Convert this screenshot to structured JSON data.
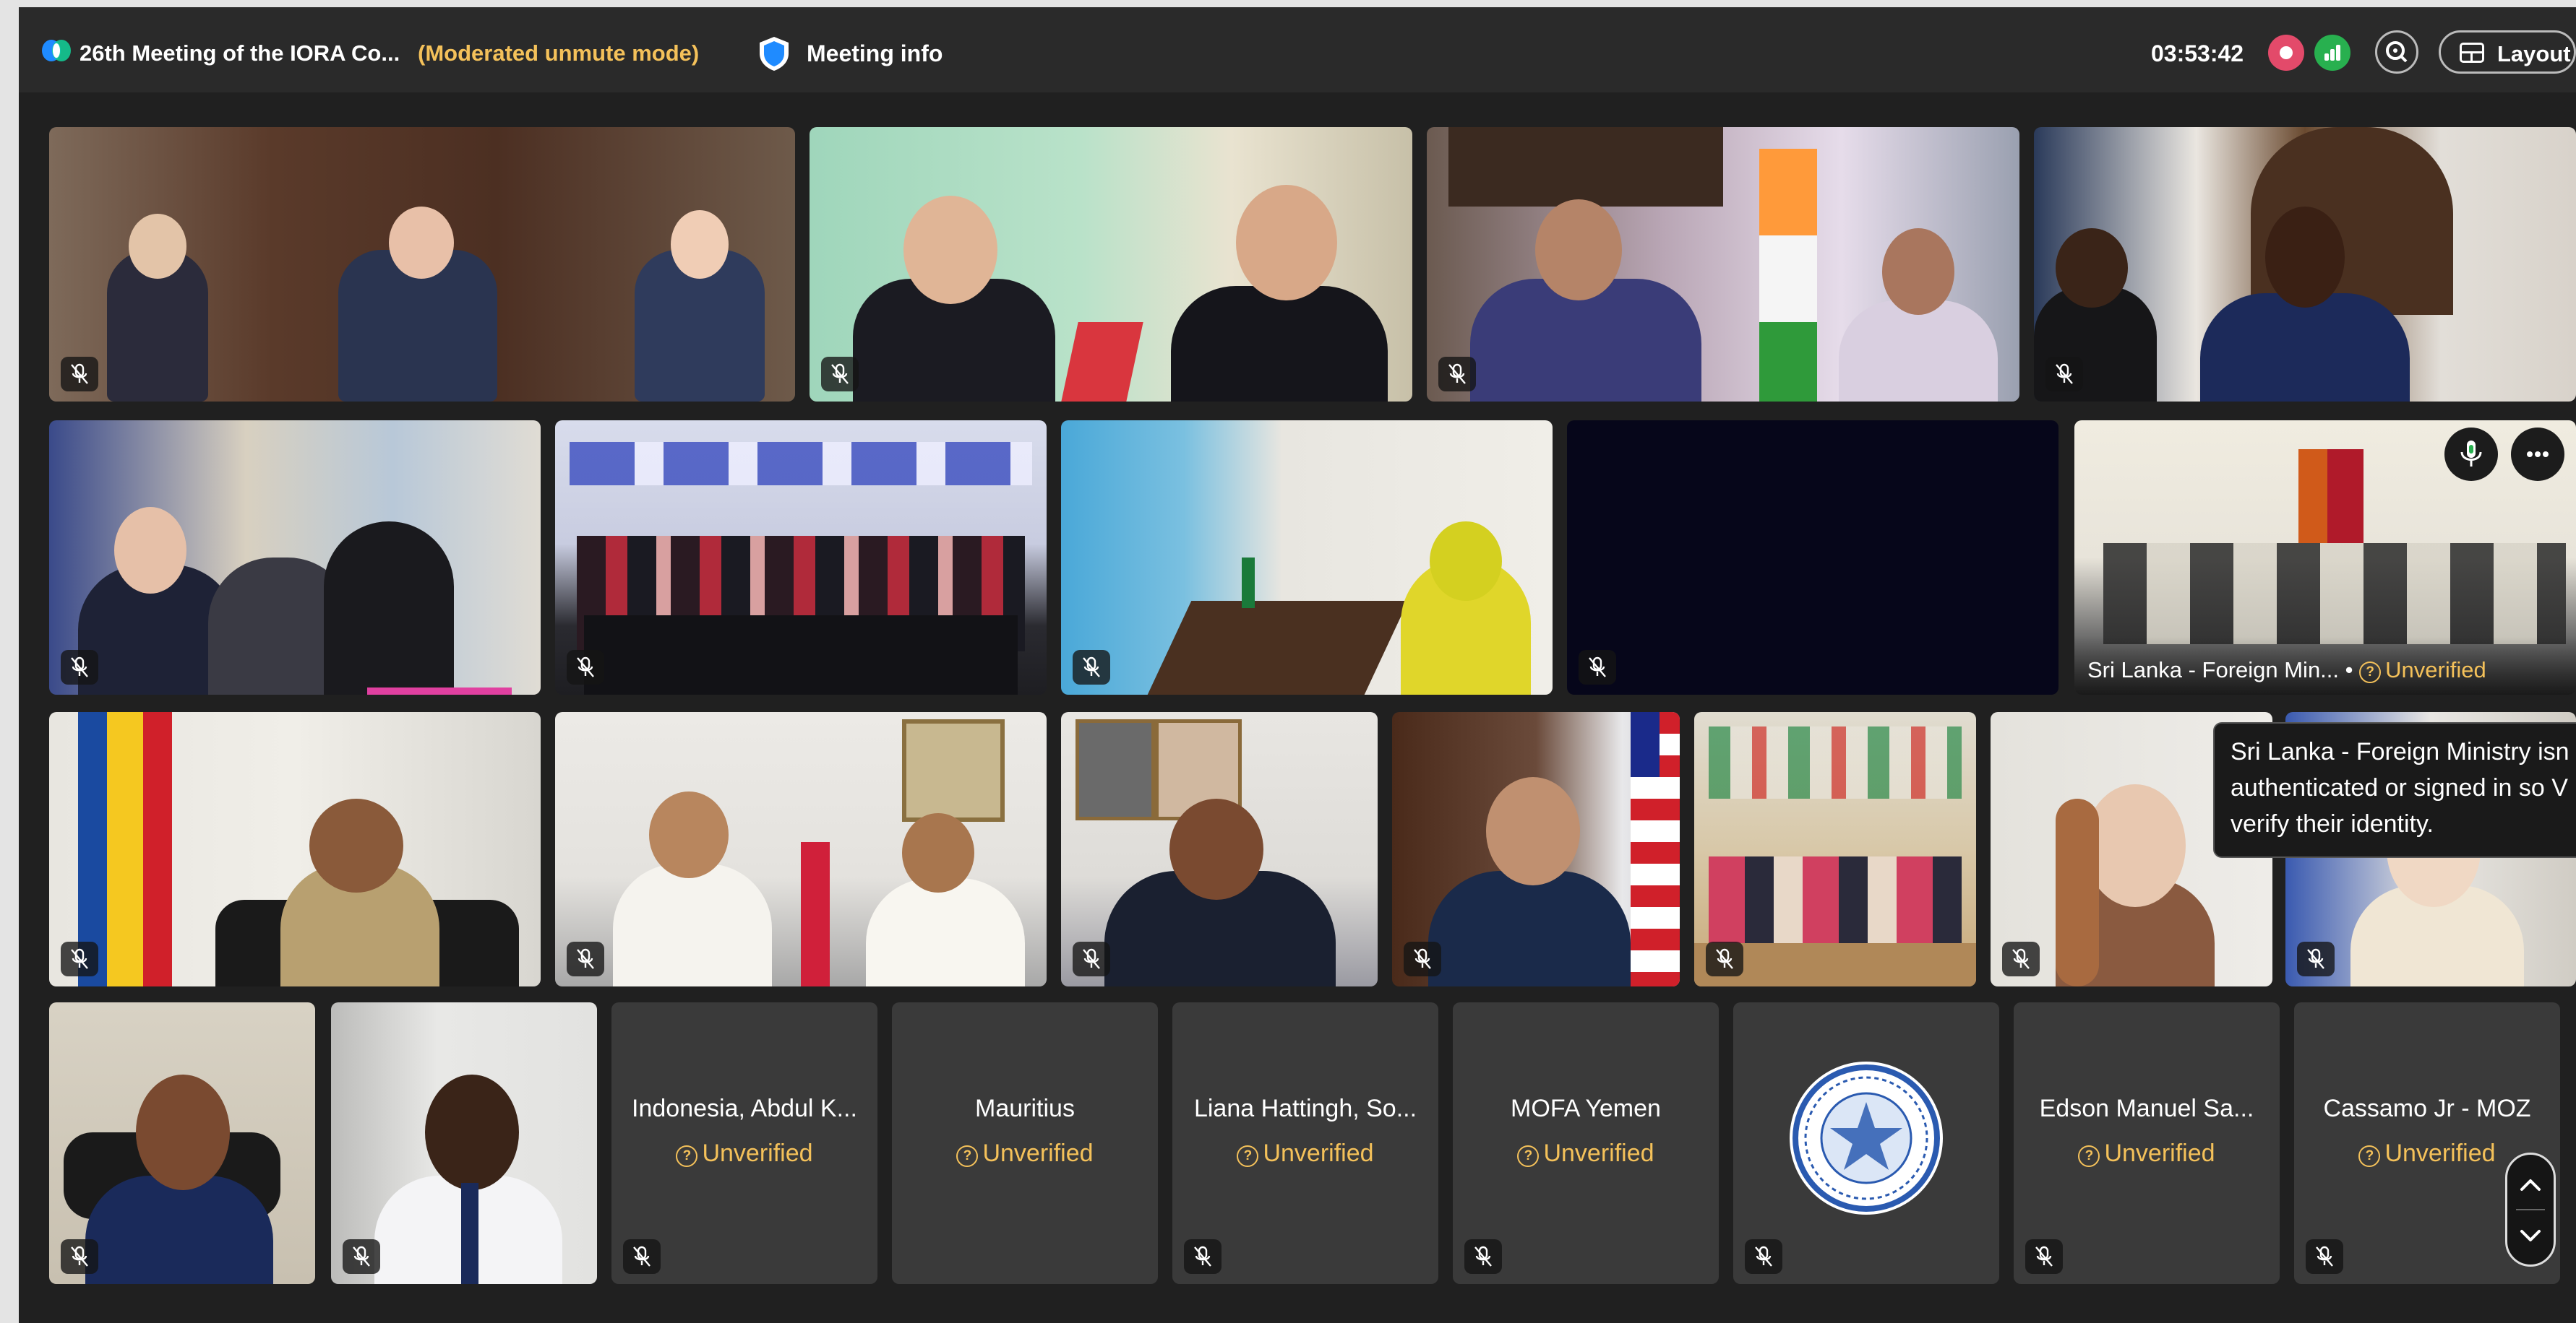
{
  "meeting": {
    "title": "26th Meeting of the IORA Co...",
    "mode": "(Moderated unmute mode)",
    "info_label": "Meeting info",
    "elapsed": "03:53:42",
    "layout_label": "Layout"
  },
  "tiles": {
    "srilanka_name": "Sri Lanka - Foreign Min...",
    "srilanka_status": "Unverified"
  },
  "tooltip": {
    "line1": "Sri Lanka - Foreign Ministry isn",
    "line2": "authenticated or signed in so V",
    "line3": "verify their identity."
  },
  "participants": [
    {
      "name": "Indonesia, Abdul K...",
      "status": "Unverified"
    },
    {
      "name": "Mauritius",
      "status": "Unverified"
    },
    {
      "name": "Liana Hattingh, So...",
      "status": "Unverified"
    },
    {
      "name": "MOFA Yemen",
      "status": "Unverified"
    },
    {
      "name": "Edson Manuel Sa...",
      "status": "Unverified"
    },
    {
      "name": "Cassamo Jr - MOZ",
      "status": "Unverified"
    }
  ],
  "colors": {
    "background": "#202020",
    "topbar": "#2a2a2a",
    "unverified": "#f4c15a",
    "record": "#e34a6a",
    "signal": "#28b04f"
  }
}
